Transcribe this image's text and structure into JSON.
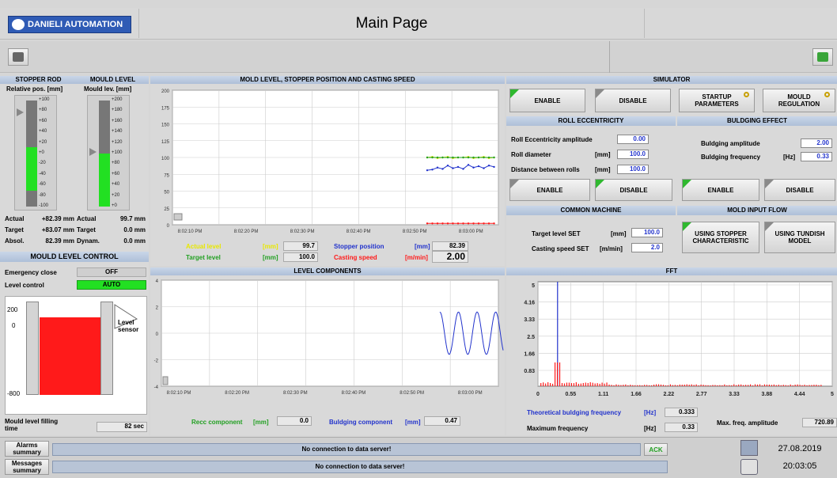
{
  "header": {
    "logo_text": "DANIELI AUTOMATION",
    "title": "Main Page"
  },
  "stopper_rod": {
    "title": "STOPPER ROD",
    "sub": "Relative pos. [mm]",
    "ticks": [
      "+100",
      "+80",
      "+60",
      "+40",
      "+20",
      "+0",
      "-20",
      "-40",
      "-60",
      "-80",
      "-100"
    ],
    "fill_pct": 0.41
  },
  "mould_level": {
    "title": "MOULD LEVEL",
    "sub": "Mould lev. [mm]",
    "ticks": [
      "+200",
      "+180",
      "+160",
      "+140",
      "+120",
      "+100",
      "+80",
      "+60",
      "+40",
      "+20",
      "+0"
    ],
    "fill_pct": 0.5
  },
  "readouts": {
    "actual_label": "Actual",
    "actual_val": "+82.39 mm",
    "target_label": "Target",
    "target_val": "+83.07 mm",
    "absol_label": "Absol.",
    "absol_val": "82.39 mm",
    "m_actual_label": "Actual",
    "m_actual_val": "99.7 mm",
    "m_target_label": "Target",
    "m_target_val": "0.0 mm",
    "m_dynam_label": "Dynam.",
    "m_dynam_val": "0.0 mm"
  },
  "mlc": {
    "title": "MOULD LEVEL CONTROL",
    "emergency_label": "Emergency close",
    "emergency_val": "OFF",
    "level_label": "Level control",
    "level_val": "AUTO",
    "tick_top": "200",
    "tick_mid": "0",
    "tick_bot": "-800",
    "sensor_label": "Level sensor",
    "filling_label": "Mould level filling time",
    "filling_val": "82 sec"
  },
  "chart1": {
    "title": "MOLD LEVEL, STOPPER POSITION AND CASTING SPEED",
    "yticks": [
      "200",
      "175",
      "150",
      "125",
      "100",
      "75",
      "50",
      "25",
      "0"
    ],
    "xticks": [
      "8:02:10 PM",
      "8:02:20 PM",
      "8:02:30 PM",
      "8:02:40 PM",
      "8:02:50 PM",
      "8:03:00 PM"
    ]
  },
  "chart1_legend": {
    "actual_label": "Actual level",
    "actual_unit": "[mm]",
    "actual_val": "99.7",
    "target_label": "Target level",
    "target_unit": "[mm]",
    "target_val": "100.0",
    "stopper_label": "Stopper position",
    "stopper_unit": "[mm]",
    "stopper_val": "82.39",
    "speed_label": "Casting speed",
    "speed_unit": "[m/min]",
    "speed_val": "2.00"
  },
  "chart2": {
    "title": "LEVEL COMPONENTS",
    "yticks": [
      "4",
      "2",
      "0",
      "-2",
      "-4"
    ],
    "xticks": [
      "8:02:10 PM",
      "8:02:20 PM",
      "8:02:30 PM",
      "8:02:40 PM",
      "8:02:50 PM",
      "8:03:00 PM"
    ]
  },
  "chart2_legend": {
    "recc_label": "Recc component",
    "recc_unit": "[mm]",
    "recc_val": "0.0",
    "bulg_label": "Buldging component",
    "bulg_unit": "[mm]",
    "bulg_val": "0.47"
  },
  "simulator": {
    "title": "SIMULATOR",
    "enable": "ENABLE",
    "disable": "DISABLE",
    "startup": "STARTUP PARAMETERS",
    "mould_reg": "MOULD REGULATION"
  },
  "roll": {
    "title": "ROLL ECCENTRICITY",
    "amp_label": "Roll Eccentricity amplitude",
    "amp_val": "0.00",
    "diam_label": "Roll diameter",
    "diam_unit": "[mm]",
    "diam_val": "100.0",
    "dist_label": "Distance between rolls",
    "dist_unit": "[mm]",
    "dist_val": "100.0",
    "enable": "ENABLE",
    "disable": "DISABLE"
  },
  "bulging": {
    "title": "BULDGING EFFECT",
    "amp_label": "Buldging amplitude",
    "amp_val": "2.00",
    "freq_label": "Buldging frequency",
    "freq_unit": "[Hz]",
    "freq_val": "0.33",
    "enable": "ENABLE",
    "disable": "DISABLE"
  },
  "common": {
    "title": "COMMON MACHINE",
    "target_label": "Target level SET",
    "target_unit": "[mm]",
    "target_val": "100.0",
    "speed_label": "Casting speed SET",
    "speed_unit": "[m/min]",
    "speed_val": "2.0"
  },
  "inflow": {
    "title": "MOLD INPUT FLOW",
    "stopper": "USING STOPPER CHARACTERISTIC",
    "tundish": "USING TUNDISH MODEL"
  },
  "fft": {
    "title": "FFT",
    "yticks": [
      "5",
      "4.16",
      "3.33",
      "2.5",
      "1.66",
      "0.83"
    ],
    "xticks": [
      "0",
      "0.55",
      "1.11",
      "1.66",
      "2.22",
      "2.77",
      "3.33",
      "3.88",
      "4.44",
      "5"
    ],
    "theo_label": "Theoretical buldging frequency",
    "theo_unit": "[Hz]",
    "theo_val": "0.333",
    "max_label": "Maximum frequency",
    "max_unit": "[Hz]",
    "max_val": "0.33",
    "amp_label": "Max. freq. amplitude",
    "amp_val": "720.89"
  },
  "footer": {
    "alarms": "Alarms summary",
    "messages": "Messages summary",
    "msg1": "No connection to data server!",
    "msg2": "No connection to data server!",
    "ack": "ACK",
    "date": "27.08.2019",
    "time": "20:03:05"
  },
  "colors": {
    "accent": "#2b4f9e",
    "green": "#22e022",
    "red": "#ff1a1a",
    "blue": "#2233cc",
    "yellow": "#e8e800"
  }
}
